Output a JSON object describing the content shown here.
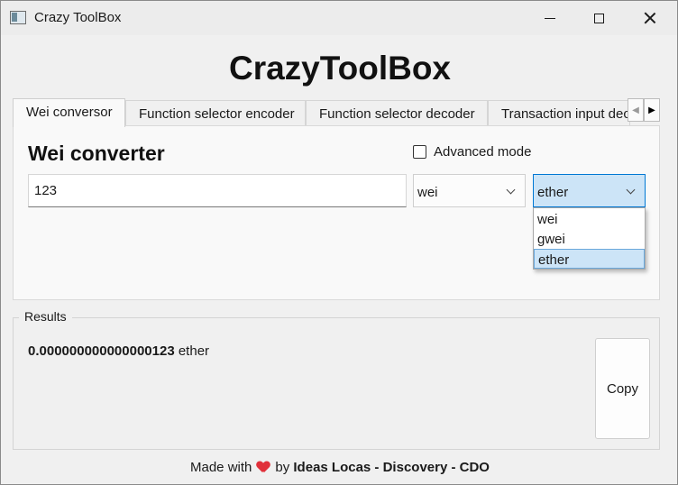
{
  "window": {
    "title": "Crazy ToolBox",
    "icons": {
      "app": "app-icon",
      "minimize": "minimize-icon",
      "maximize": "maximize-icon",
      "close": "close-icon"
    }
  },
  "header": {
    "title": "CrazyToolBox"
  },
  "tabs": [
    {
      "label": "Wei conversor",
      "active": true
    },
    {
      "label": "Function selector encoder",
      "active": false
    },
    {
      "label": "Function selector decoder",
      "active": false
    },
    {
      "label": "Transaction input decoder",
      "active": false
    }
  ],
  "tab_scroll": {
    "left_glyph": "◀",
    "right_glyph": "▶"
  },
  "converter": {
    "title": "Wei converter",
    "advanced_mode_label": "Advanced mode",
    "advanced_mode_checked": false,
    "amount_value": "123",
    "from_unit": "wei",
    "to_unit": "ether",
    "dropdown_options": [
      "wei",
      "gwei",
      "ether"
    ],
    "dropdown_open": true,
    "highlighted_option": "ether"
  },
  "results": {
    "label": "Results",
    "value": "0.000000000000000123",
    "unit": "ether",
    "copy_label": "Copy"
  },
  "footer": {
    "prefix": "Made with",
    "suffix": "by",
    "credit": "Ideas Locas - Discovery - CDO",
    "heart_icon": "heart-icon",
    "heart_color": "#e0303a"
  },
  "colors": {
    "selection": "#cce4f7",
    "accent": "#0078d4"
  }
}
